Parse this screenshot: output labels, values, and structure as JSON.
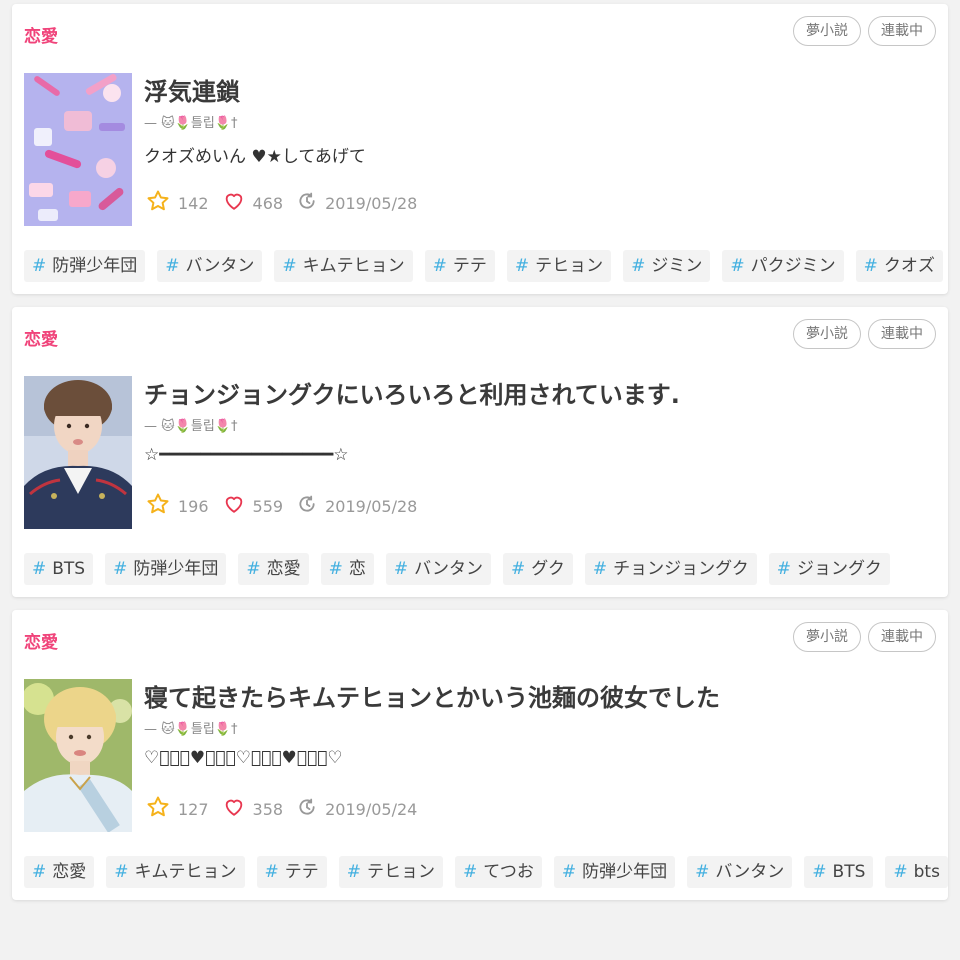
{
  "cards": [
    {
      "genre": "恋愛",
      "badges": [
        "夢小説",
        "連載中"
      ],
      "title": "浮気連鎖",
      "author": "— 🐱🌷틀립🌷†",
      "description": "クオズめいん ♥★してあげて",
      "stars": "142",
      "likes": "468",
      "date": "2019/05/28",
      "tags": [
        "防弾少年団",
        "バンタン",
        "キムテヒョン",
        "テテ",
        "テヒョン",
        "ジミン",
        "パクジミン",
        "クオズ",
        ""
      ]
    },
    {
      "genre": "恋愛",
      "badges": [
        "夢小説",
        "連載中"
      ],
      "title": "チョンジョングクにいろいろと利用されています.",
      "author": "— 🐱🌷틀립🌷†",
      "description": "☆━━━━━━━━━━━━━━━━━☆",
      "stars": "196",
      "likes": "559",
      "date": "2019/05/28",
      "tags": [
        "BTS",
        "防弾少年団",
        "恋愛",
        "恋",
        "バンタン",
        "グク",
        "チョンジョングク",
        "ジョングク"
      ]
    },
    {
      "genre": "恋愛",
      "badges": [
        "夢小説",
        "連載中"
      ],
      "title": "寝て起きたらキムテヒョンとかいう池麺の彼女でした",
      "author": "— 🐱🌷틀립🌷†",
      "description": "♡ﾟ･｡♥｡･ﾟ♡ﾟ･｡♥｡･ﾟ♡",
      "stars": "127",
      "likes": "358",
      "date": "2019/05/24",
      "tags": [
        "恋愛",
        "キムテヒョン",
        "テテ",
        "テヒョン",
        "てつお",
        "防弾少年団",
        "バンタン",
        "BTS",
        "bts"
      ]
    }
  ],
  "tag_prefix": "#",
  "colors": {
    "genre": "#f0437a",
    "hash": "#44b0e0",
    "star_icon": "#f5b21b",
    "heart_icon": "#e8364f",
    "background": "#f2f2f2"
  },
  "icons": [
    "star-icon",
    "heart-icon",
    "clock-icon"
  ]
}
